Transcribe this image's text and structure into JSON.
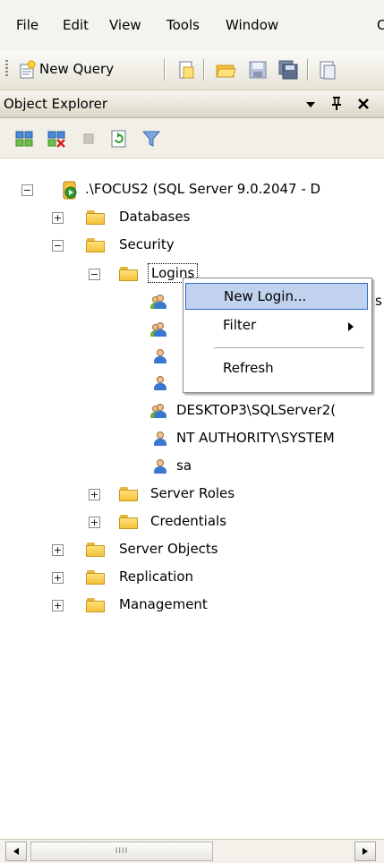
{
  "menubar": {
    "items": [
      "File",
      "Edit",
      "View",
      "Tools",
      "Window",
      "C"
    ]
  },
  "toolbar": {
    "new_query_label": "New Query"
  },
  "object_explorer": {
    "title": "Object Explorer",
    "pin_glyph": "↓ 1",
    "close_glyph": "X"
  },
  "tree": {
    "server": ".\\FOCUS2 (SQL Server 9.0.2047 - D",
    "databases": "Databases",
    "security": "Security",
    "logins": "Logins",
    "login_partial_1": "s",
    "login_desktop": "DESKTOP3\\SQLServer2(",
    "login_nt": "NT AUTHORITY\\SYSTEM",
    "login_sa": "sa",
    "server_roles": "Server Roles",
    "credentials": "Credentials",
    "server_objects": "Server Objects",
    "replication": "Replication",
    "management": "Management"
  },
  "context_menu": {
    "new_login": "New Login...",
    "filter": "Filter",
    "refresh": "Refresh"
  },
  "scrollbar": {
    "grip": "IIII"
  },
  "colors": {
    "menu_highlight": "#c1d2ee",
    "folder": "#f4c23b",
    "server_green": "#2f9a2f"
  }
}
